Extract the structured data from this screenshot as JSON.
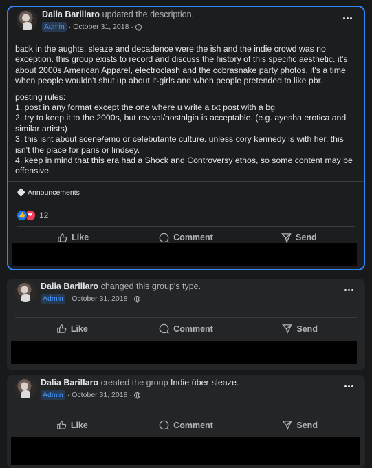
{
  "posts": [
    {
      "author": "Dalia Barillaro",
      "action": "updated the description.",
      "badge": "Admin",
      "date": "October 31, 2018",
      "paragraphs": [
        "back in the aughts, sleaze and decadence were the ish and the indie crowd was no exception. this group exists to record and discuss the history of this specific aesthetic. it's about 2000s American Apparel, electroclash and the cobrasnake party photos. it's a time when people wouldn't shut up about it-girls and when people pretended to like pbr."
      ],
      "rules_heading": "posting rules:",
      "rules": [
        "1. post in any format except the one where u write a txt post with a bg",
        "2. try to keep it to the 2000s, but revival/nostalgia is acceptable. (e.g. ayesha erotica and similar artists)",
        "3. this isnt about scene/emo or celebutante culture. unless cory kennedy is with her, this isn't the place for paris or lindsey.",
        "4. keep in mind that this era had a Shock and Controversy ethos, so some content may be offensive."
      ],
      "topic": "Announcements",
      "reaction_count": "12"
    },
    {
      "author": "Dalia Barillaro",
      "action": "changed this group's type.",
      "badge": "Admin",
      "date": "October 31, 2018"
    },
    {
      "author": "Dalia Barillaro",
      "action": "created the group",
      "group_name": "Indie über-sleaze",
      "trailing": ".",
      "badge": "Admin",
      "date": "October 31, 2018"
    }
  ],
  "actions": {
    "like": "Like",
    "comment": "Comment",
    "send": "Send"
  },
  "colors": {
    "accent": "#2d88ff",
    "admin": "#4599ff",
    "card": "#242526",
    "background": "#18191a"
  }
}
